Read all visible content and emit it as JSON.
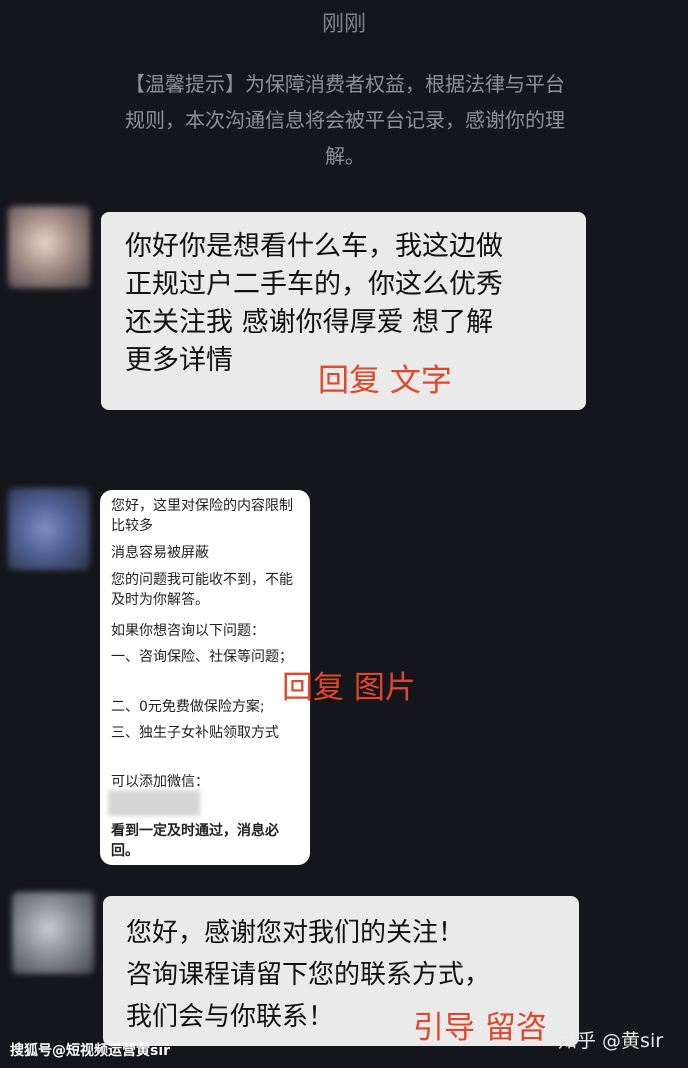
{
  "timestamp": "刚刚",
  "notice": {
    "line1": "【温馨提示】为保障消费者权益，根据法律与平台",
    "line2": "规则，本次沟通信息将会被平台记录，感谢你的理",
    "line3": "解。"
  },
  "messages": [
    {
      "lines": [
        "你好你是想看什么车，我这边做",
        "正规过户二手车的，你这么优秀",
        "还关注我 感谢你得厚爱  想了解",
        "更多详情"
      ]
    },
    {
      "image_lines": [
        "您好，这里对保险的内容限制比较多",
        "消息容易被屏蔽",
        "您的问题我可能收不到，不能及时为你解答。",
        "如果你想咨询以下问题：",
        "一、咨询保险、社保等问题；",
        "二、0元免费做保险方案;",
        "三、独生子女补贴领取方式",
        "可以添加微信：",
        "看到一定及时通过，消息必回。"
      ]
    },
    {
      "lines": [
        "您好，感谢您对我们的关注！",
        "咨询课程请留下您的联系方式，",
        "我们会与你联系！"
      ]
    }
  ],
  "annotations": {
    "reply_text": "回复 文字",
    "reply_image": "回复 图片",
    "guide_leave": "引导 留咨"
  },
  "watermarks": {
    "left": "搜狐号@短视频运营黄sir",
    "right": "知乎 @黄sir"
  },
  "colors": {
    "background": "#15161c",
    "bubble": "#eaeaea",
    "annotation": "#e0462a"
  }
}
